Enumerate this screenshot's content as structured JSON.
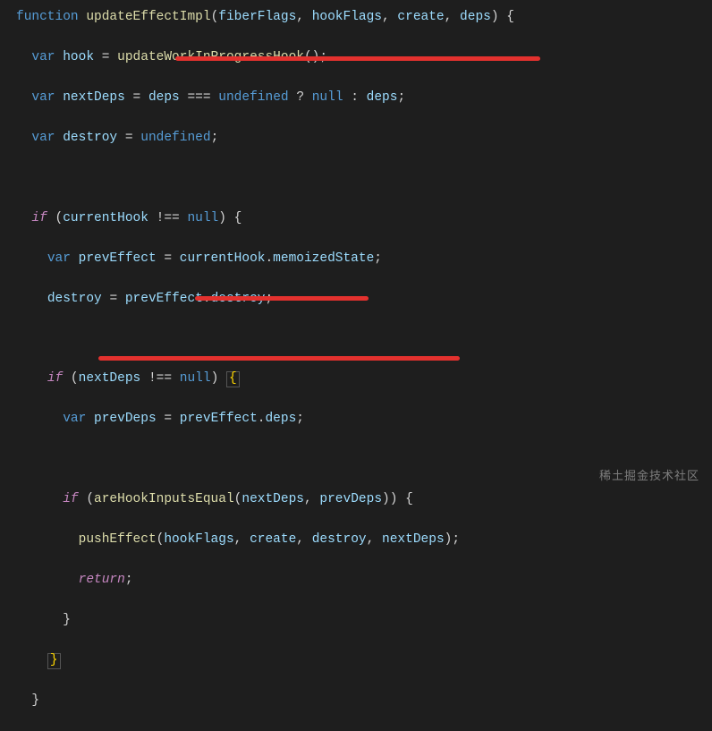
{
  "code": {
    "l1a": "function",
    "l1b": "updateEffectImpl",
    "l1c": "fiberFlags",
    "l1d": "hookFlags",
    "l1e": "create",
    "l1f": "deps",
    "l2a": "var",
    "l2b": "hook",
    "l2c": "updateWorkInProgressHook",
    "l3a": "var",
    "l3b": "nextDeps",
    "l3c": "deps",
    "l3d": "undefined",
    "l3e": "null",
    "l3f": "deps",
    "l4a": "var",
    "l4b": "destroy",
    "l4c": "undefined",
    "l6a": "if",
    "l6b": "currentHook",
    "l6c": "null",
    "l7a": "var",
    "l7b": "prevEffect",
    "l7c": "currentHook",
    "l7d": "memoizedState",
    "l8a": "destroy",
    "l8b": "prevEffect",
    "l8c": "destroy",
    "l10a": "if",
    "l10b": "nextDeps",
    "l10c": "null",
    "l11a": "var",
    "l11b": "prevDeps",
    "l11c": "prevEffect",
    "l11d": "deps",
    "l13a": "if",
    "l13b": "areHookInputsEqual",
    "l13c": "nextDeps",
    "l13d": "prevDeps",
    "l14a": "pushEffect",
    "l14b": "hookFlags",
    "l14c": "create",
    "l14d": "destroy",
    "l14e": "nextDeps",
    "l15a": "return"
  },
  "watermark": "稀土掘金技术社区"
}
